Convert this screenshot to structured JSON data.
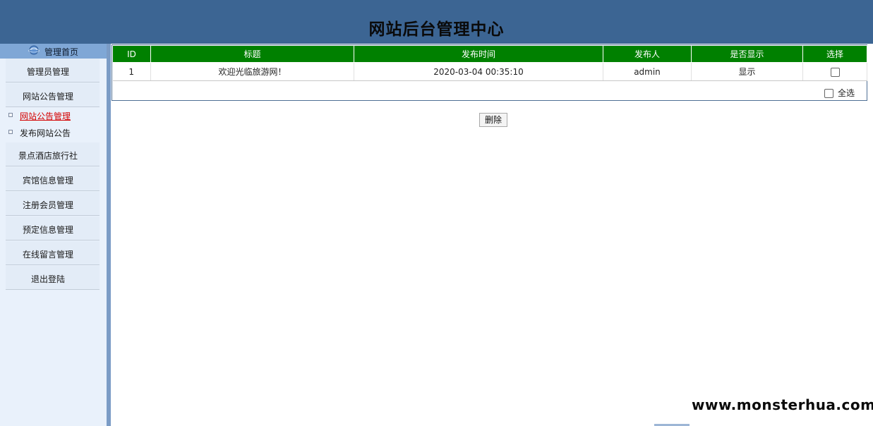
{
  "header": {
    "title": "网站后台管理中心"
  },
  "sidebar": {
    "home_label": "管理首页",
    "items": [
      {
        "label": "管理员管理"
      },
      {
        "label": "网站公告管理"
      },
      {
        "label": "景点酒店旅行社"
      },
      {
        "label": "宾馆信息管理"
      },
      {
        "label": "注册会员管理"
      },
      {
        "label": "预定信息管理"
      },
      {
        "label": "在线留言管理"
      },
      {
        "label": "退出登陆"
      }
    ],
    "sub_items": [
      {
        "label": "网站公告管理",
        "active": true
      },
      {
        "label": "发布网站公告",
        "active": false
      }
    ]
  },
  "table": {
    "headers": [
      "ID",
      "标题",
      "发布时间",
      "发布人",
      "是否显示",
      "选择"
    ],
    "rows": [
      {
        "id": "1",
        "title": "欢迎光临旅游网！",
        "time": "2020-03-04 00:35:10",
        "publisher": "admin",
        "display": "显示",
        "checked": false
      }
    ],
    "select_all_label": "全选"
  },
  "actions": {
    "delete_label": "删除"
  },
  "watermark": {
    "text": "www.monsterhua.com"
  },
  "colors": {
    "header_bg": "#3c6593",
    "table_header_bg": "#008000",
    "active_link": "#d40000",
    "sidebar_bg": "#e9f1fb"
  }
}
